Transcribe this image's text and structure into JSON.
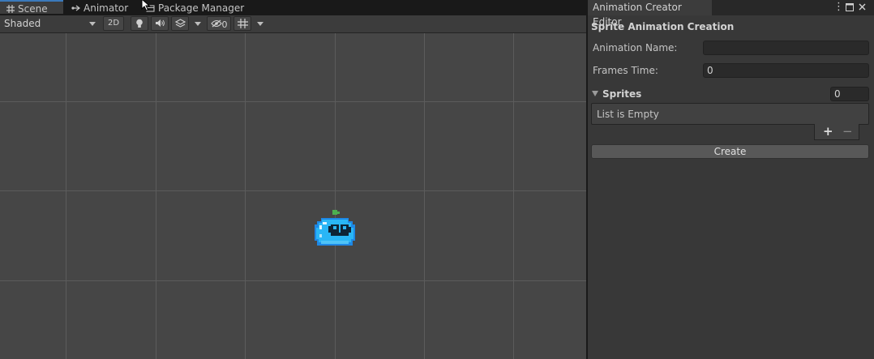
{
  "scene_tabs": [
    {
      "label": "Scene",
      "icon": "grid-icon",
      "active": true
    },
    {
      "label": "Animator",
      "icon": "animator-icon",
      "active": false
    },
    {
      "label": "Package Manager",
      "icon": "package-icon",
      "active": false
    }
  ],
  "toolbar": {
    "shading_mode": "Shaded",
    "mode_2d": "2D",
    "hidden_count": "0",
    "icons": [
      "lightbulb-icon",
      "audio-icon",
      "effects-icon",
      "visibility-icon",
      "gizmo-grid-icon"
    ]
  },
  "editor": {
    "window_title": "Animation Creator Editor",
    "section_title": "Sprite Animation Creation",
    "animation_name_label": "Animation Name:",
    "animation_name_value": "",
    "frames_time_label": "Frames Time:",
    "frames_time_value": "0",
    "sprites_label": "Sprites",
    "sprites_count": "0",
    "list_empty_text": "List is Empty",
    "add_label": "+",
    "remove_label": "−",
    "create_label": "Create"
  },
  "colors": {
    "accent": "#3a79bb",
    "viewport_bg": "#464646",
    "sprite_body": "#29b6f6",
    "sprite_leaf": "#4caf50"
  }
}
